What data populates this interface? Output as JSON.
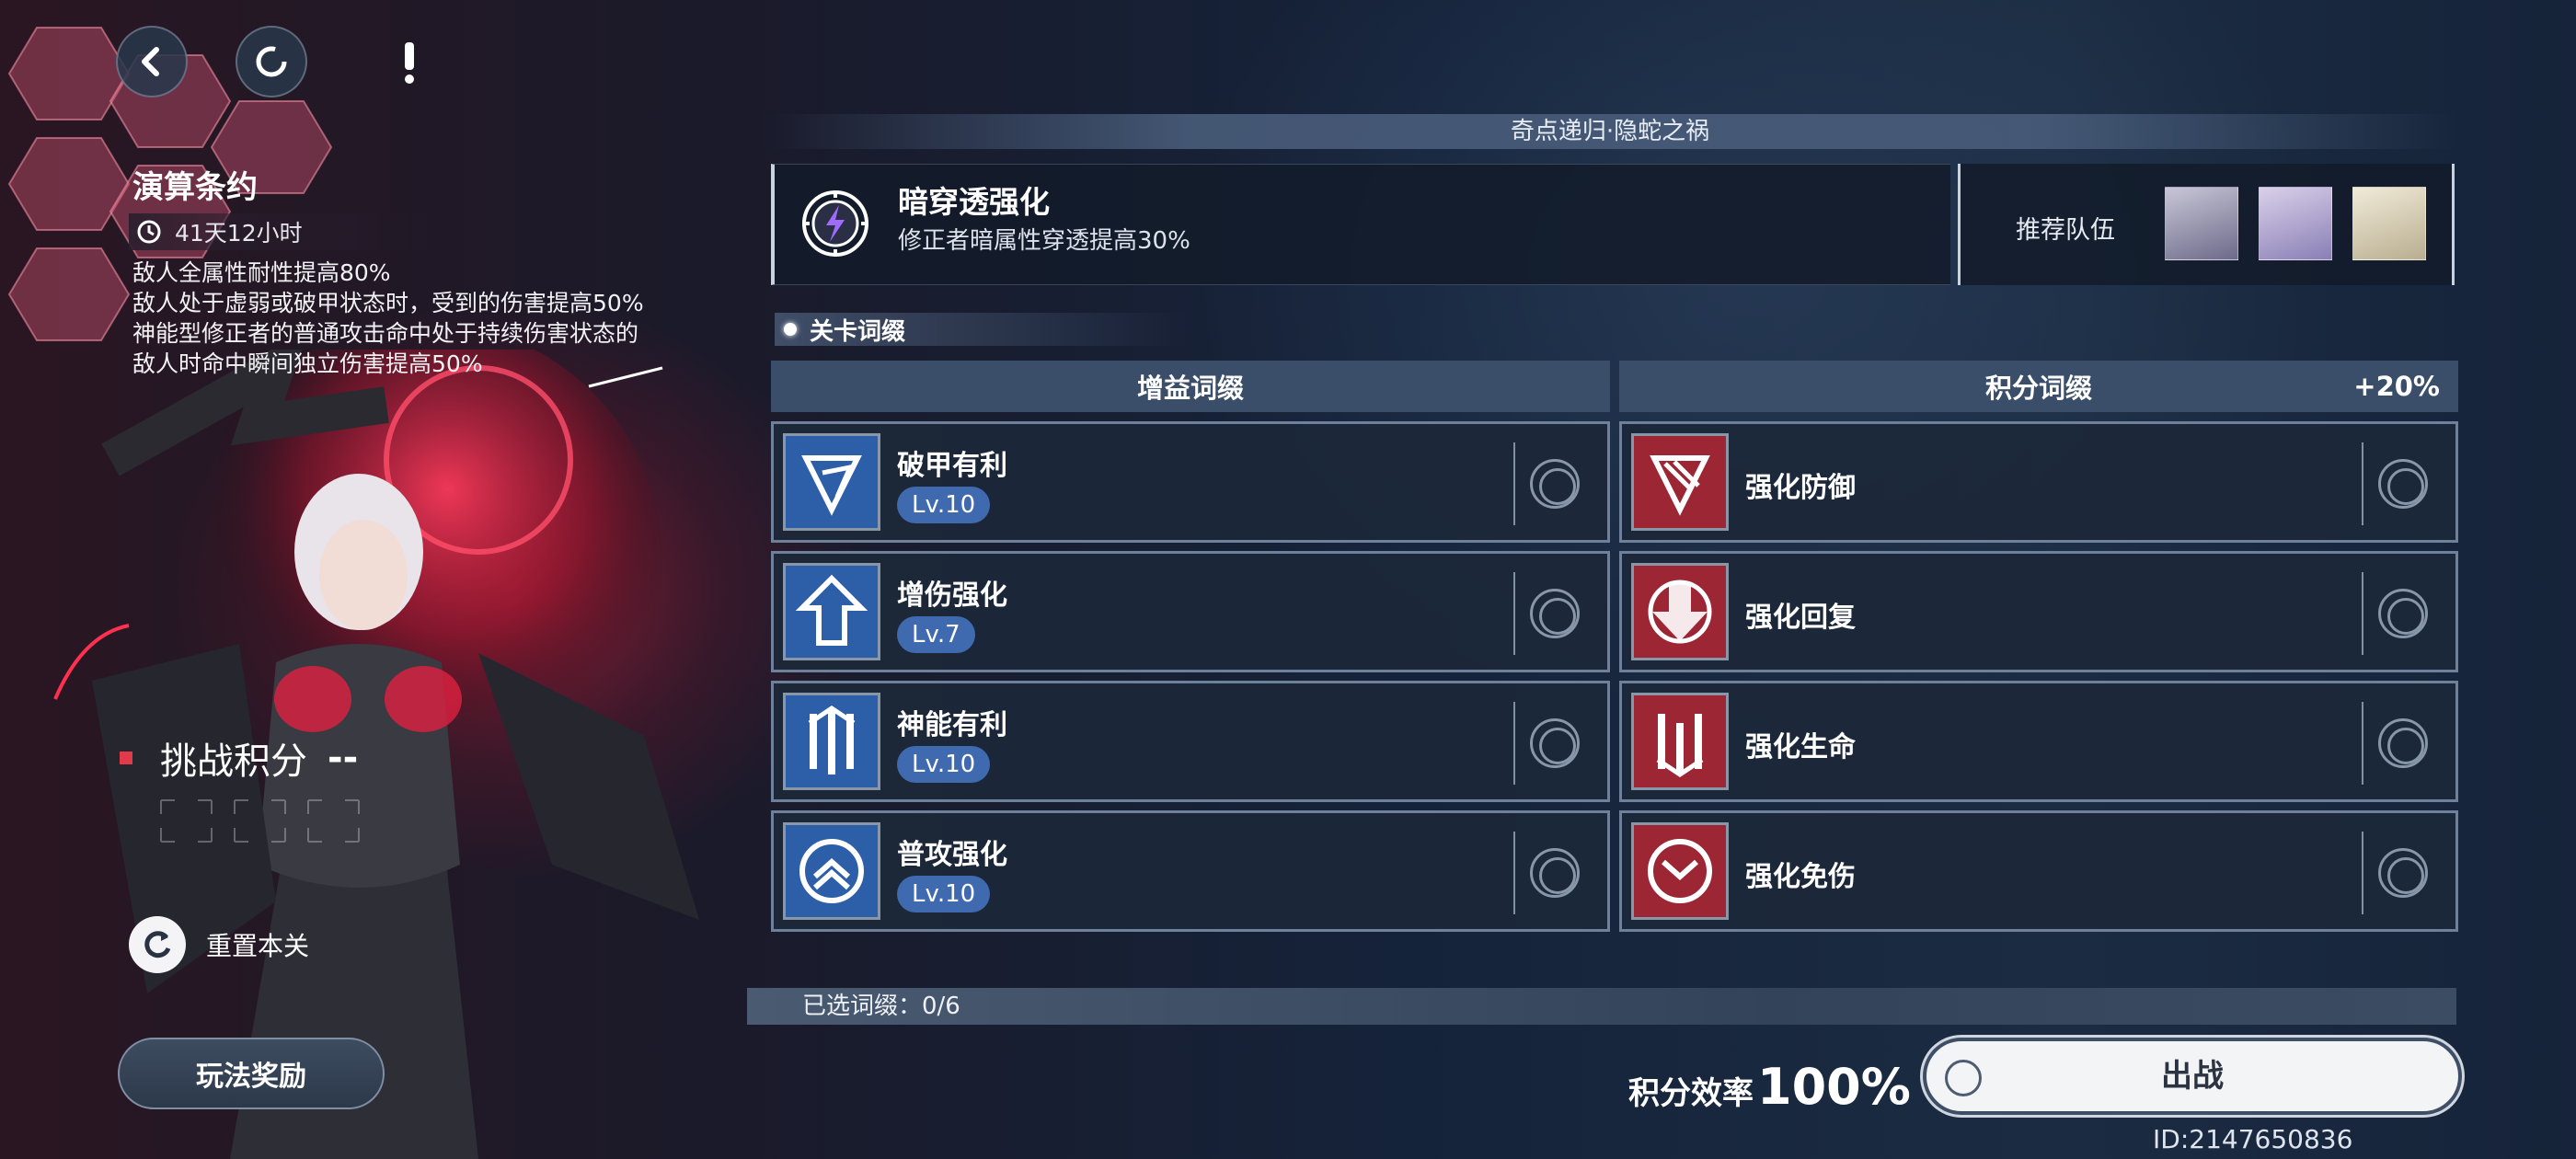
{
  "left_panel": {
    "title": "演算条约",
    "time_left": "41天12小时",
    "description": [
      "敌人全属性耐性提高80%",
      "敌人处于虚弱或破甲状态时，受到的伤害提高50%",
      "神能型修正者的普通攻击命中处于持续伤害状态的",
      "敌人时命中瞬间独立伤害提高50%"
    ],
    "challenge_score_label": "挑战积分",
    "challenge_score_value": "--",
    "reset_label": "重置本关",
    "reward_button": "玩法奖励"
  },
  "stage": {
    "name": "奇点递归·隐蛇之祸",
    "buff_title": "暗穿透强化",
    "buff_desc": "修正者暗属性穿透提高30%",
    "team_label": "推荐队伍",
    "affix_section_label": "关卡词缀"
  },
  "columns": {
    "gain_header": "增益词缀",
    "score_header": "积分词缀",
    "score_bonus": "+20%"
  },
  "gain_affixes": [
    {
      "name": "破甲有利",
      "level": "Lv.10",
      "icon": "armor-break-icon"
    },
    {
      "name": "增伤强化",
      "level": "Lv.7",
      "icon": "damage-up-icon"
    },
    {
      "name": "神能有利",
      "level": "Lv.10",
      "icon": "psi-energy-icon"
    },
    {
      "name": "普攻强化",
      "level": "Lv.10",
      "icon": "basic-attack-icon"
    }
  ],
  "score_affixes": [
    {
      "name": "强化防御",
      "icon": "defense-icon"
    },
    {
      "name": "强化回复",
      "icon": "recovery-icon"
    },
    {
      "name": "强化生命",
      "icon": "life-icon"
    },
    {
      "name": "强化免伤",
      "icon": "damage-reduction-icon"
    }
  ],
  "footer": {
    "selected_label": "已选词缀：0/6",
    "efficiency_label": "积分效率",
    "efficiency_value": "100%",
    "go_button": "出战",
    "uid": "ID:2147650836"
  },
  "colors": {
    "accent_red": "#e23a4a",
    "level_badge": "#3f6ab0",
    "gain_icon_bg": "#2c5fa8",
    "score_icon_bg": "#9c2634"
  }
}
